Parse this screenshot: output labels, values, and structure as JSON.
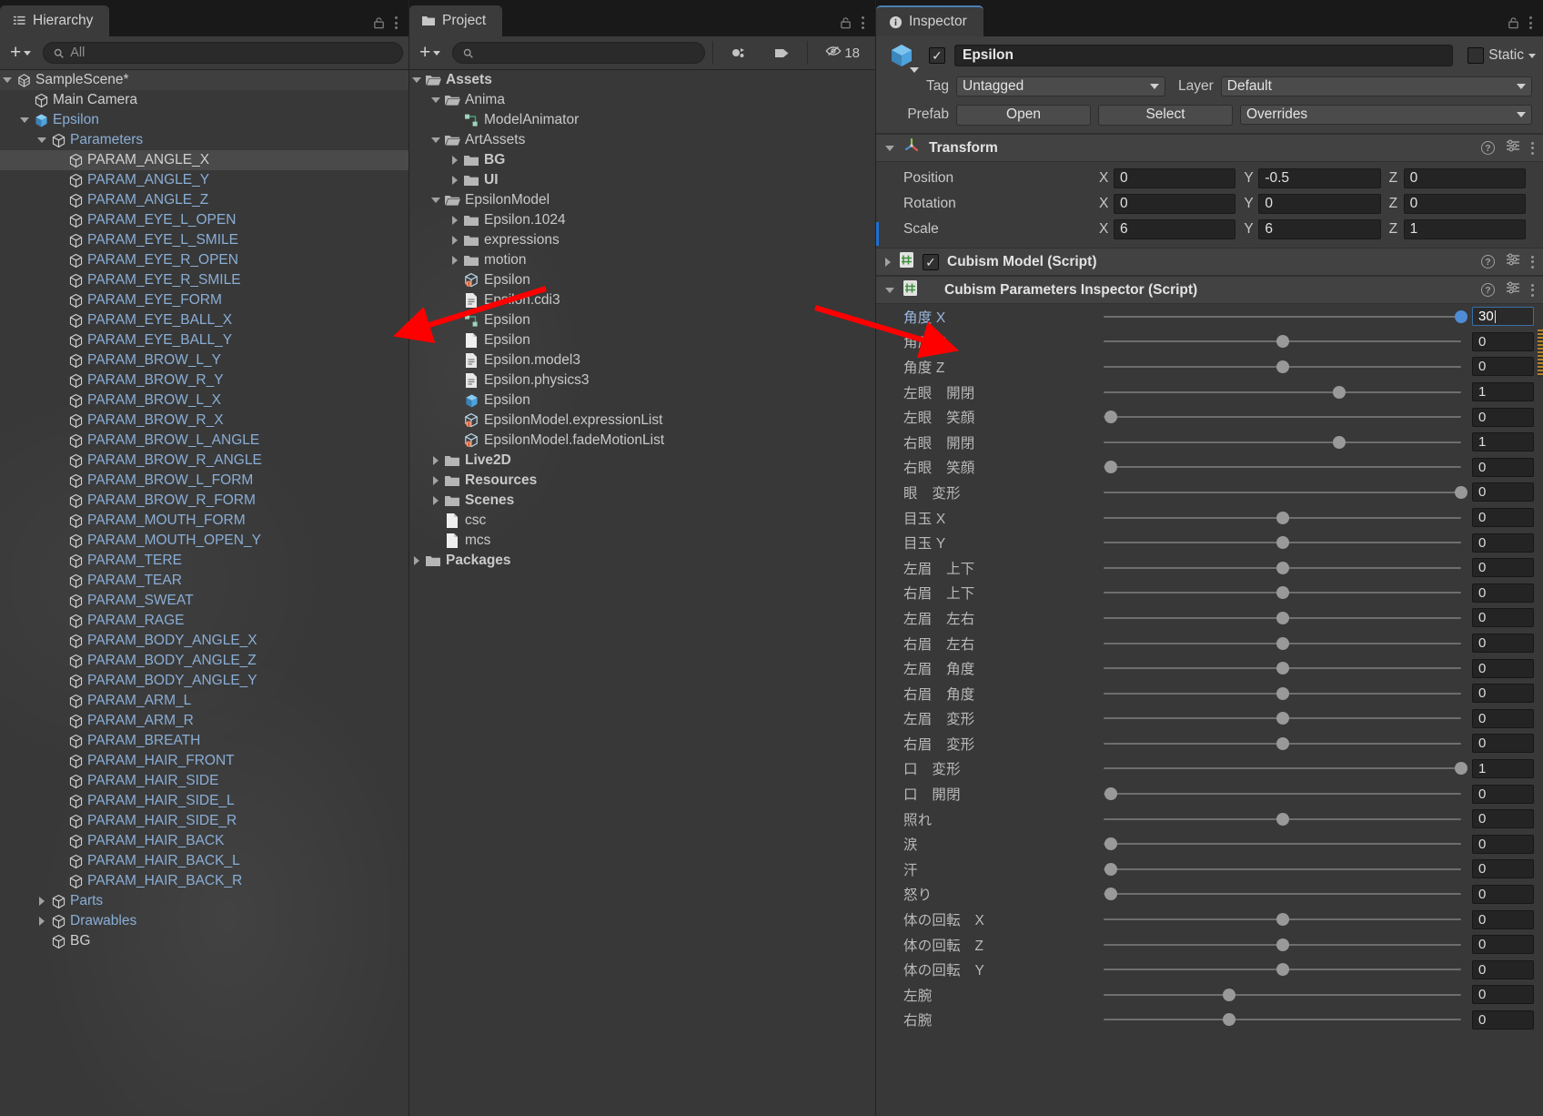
{
  "hierarchy": {
    "tab_label": "Hierarchy",
    "tab_icon": "hierarchy-icon",
    "lock_icon": "lock-icon",
    "menu_icon": "kebab-menu-icon",
    "create_label": "+",
    "search_placeholder": "All",
    "items": [
      {
        "label": "SampleScene*",
        "depth": 1,
        "twisty": "down",
        "icon": "scene-icon",
        "color": "white",
        "selected": false,
        "scene": true
      },
      {
        "label": "Main Camera",
        "depth": 2,
        "twisty": "none",
        "icon": "gameobject-icon",
        "color": "white"
      },
      {
        "label": "Epsilon",
        "depth": 2,
        "twisty": "down",
        "icon": "prefab-icon",
        "color": "blue"
      },
      {
        "label": "Parameters",
        "depth": 3,
        "twisty": "down",
        "icon": "gameobject-icon",
        "color": "blue"
      },
      {
        "label": "PARAM_ANGLE_X",
        "depth": 4,
        "twisty": "none",
        "icon": "gameobject-icon",
        "color": "white",
        "selected": true
      },
      {
        "label": "PARAM_ANGLE_Y",
        "depth": 4,
        "twisty": "none",
        "icon": "gameobject-icon",
        "color": "blue"
      },
      {
        "label": "PARAM_ANGLE_Z",
        "depth": 4,
        "twisty": "none",
        "icon": "gameobject-icon",
        "color": "blue"
      },
      {
        "label": "PARAM_EYE_L_OPEN",
        "depth": 4,
        "twisty": "none",
        "icon": "gameobject-icon",
        "color": "blue"
      },
      {
        "label": "PARAM_EYE_L_SMILE",
        "depth": 4,
        "twisty": "none",
        "icon": "gameobject-icon",
        "color": "blue"
      },
      {
        "label": "PARAM_EYE_R_OPEN",
        "depth": 4,
        "twisty": "none",
        "icon": "gameobject-icon",
        "color": "blue"
      },
      {
        "label": "PARAM_EYE_R_SMILE",
        "depth": 4,
        "twisty": "none",
        "icon": "gameobject-icon",
        "color": "blue"
      },
      {
        "label": "PARAM_EYE_FORM",
        "depth": 4,
        "twisty": "none",
        "icon": "gameobject-icon",
        "color": "blue"
      },
      {
        "label": "PARAM_EYE_BALL_X",
        "depth": 4,
        "twisty": "none",
        "icon": "gameobject-icon",
        "color": "blue"
      },
      {
        "label": "PARAM_EYE_BALL_Y",
        "depth": 4,
        "twisty": "none",
        "icon": "gameobject-icon",
        "color": "blue"
      },
      {
        "label": "PARAM_BROW_L_Y",
        "depth": 4,
        "twisty": "none",
        "icon": "gameobject-icon",
        "color": "blue"
      },
      {
        "label": "PARAM_BROW_R_Y",
        "depth": 4,
        "twisty": "none",
        "icon": "gameobject-icon",
        "color": "blue"
      },
      {
        "label": "PARAM_BROW_L_X",
        "depth": 4,
        "twisty": "none",
        "icon": "gameobject-icon",
        "color": "blue"
      },
      {
        "label": "PARAM_BROW_R_X",
        "depth": 4,
        "twisty": "none",
        "icon": "gameobject-icon",
        "color": "blue"
      },
      {
        "label": "PARAM_BROW_L_ANGLE",
        "depth": 4,
        "twisty": "none",
        "icon": "gameobject-icon",
        "color": "blue"
      },
      {
        "label": "PARAM_BROW_R_ANGLE",
        "depth": 4,
        "twisty": "none",
        "icon": "gameobject-icon",
        "color": "blue"
      },
      {
        "label": "PARAM_BROW_L_FORM",
        "depth": 4,
        "twisty": "none",
        "icon": "gameobject-icon",
        "color": "blue"
      },
      {
        "label": "PARAM_BROW_R_FORM",
        "depth": 4,
        "twisty": "none",
        "icon": "gameobject-icon",
        "color": "blue"
      },
      {
        "label": "PARAM_MOUTH_FORM",
        "depth": 4,
        "twisty": "none",
        "icon": "gameobject-icon",
        "color": "blue"
      },
      {
        "label": "PARAM_MOUTH_OPEN_Y",
        "depth": 4,
        "twisty": "none",
        "icon": "gameobject-icon",
        "color": "blue"
      },
      {
        "label": "PARAM_TERE",
        "depth": 4,
        "twisty": "none",
        "icon": "gameobject-icon",
        "color": "blue"
      },
      {
        "label": "PARAM_TEAR",
        "depth": 4,
        "twisty": "none",
        "icon": "gameobject-icon",
        "color": "blue"
      },
      {
        "label": "PARAM_SWEAT",
        "depth": 4,
        "twisty": "none",
        "icon": "gameobject-icon",
        "color": "blue"
      },
      {
        "label": "PARAM_RAGE",
        "depth": 4,
        "twisty": "none",
        "icon": "gameobject-icon",
        "color": "blue"
      },
      {
        "label": "PARAM_BODY_ANGLE_X",
        "depth": 4,
        "twisty": "none",
        "icon": "gameobject-icon",
        "color": "blue"
      },
      {
        "label": "PARAM_BODY_ANGLE_Z",
        "depth": 4,
        "twisty": "none",
        "icon": "gameobject-icon",
        "color": "blue"
      },
      {
        "label": "PARAM_BODY_ANGLE_Y",
        "depth": 4,
        "twisty": "none",
        "icon": "gameobject-icon",
        "color": "blue"
      },
      {
        "label": "PARAM_ARM_L",
        "depth": 4,
        "twisty": "none",
        "icon": "gameobject-icon",
        "color": "blue"
      },
      {
        "label": "PARAM_ARM_R",
        "depth": 4,
        "twisty": "none",
        "icon": "gameobject-icon",
        "color": "blue"
      },
      {
        "label": "PARAM_BREATH",
        "depth": 4,
        "twisty": "none",
        "icon": "gameobject-icon",
        "color": "blue"
      },
      {
        "label": "PARAM_HAIR_FRONT",
        "depth": 4,
        "twisty": "none",
        "icon": "gameobject-icon",
        "color": "blue"
      },
      {
        "label": "PARAM_HAIR_SIDE",
        "depth": 4,
        "twisty": "none",
        "icon": "gameobject-icon",
        "color": "blue"
      },
      {
        "label": "PARAM_HAIR_SIDE_L",
        "depth": 4,
        "twisty": "none",
        "icon": "gameobject-icon",
        "color": "blue"
      },
      {
        "label": "PARAM_HAIR_SIDE_R",
        "depth": 4,
        "twisty": "none",
        "icon": "gameobject-icon",
        "color": "blue"
      },
      {
        "label": "PARAM_HAIR_BACK",
        "depth": 4,
        "twisty": "none",
        "icon": "gameobject-icon",
        "color": "blue"
      },
      {
        "label": "PARAM_HAIR_BACK_L",
        "depth": 4,
        "twisty": "none",
        "icon": "gameobject-icon",
        "color": "blue"
      },
      {
        "label": "PARAM_HAIR_BACK_R",
        "depth": 4,
        "twisty": "none",
        "icon": "gameobject-icon",
        "color": "blue"
      },
      {
        "label": "Parts",
        "depth": 3,
        "twisty": "right",
        "icon": "gameobject-icon",
        "color": "blue"
      },
      {
        "label": "Drawables",
        "depth": 3,
        "twisty": "right",
        "icon": "gameobject-icon",
        "color": "blue"
      },
      {
        "label": "BG",
        "depth": 3,
        "twisty": "none",
        "icon": "gameobject-icon",
        "color": "white"
      }
    ]
  },
  "project": {
    "tab_label": "Project",
    "tab_icon": "folder-icon",
    "lock_icon": "lock-icon",
    "menu_icon": "kebab-menu-icon",
    "create_label": "+",
    "search_placeholder": "",
    "filter_type_icon": "type-filter-icon",
    "filter_label_icon": "label-filter-icon",
    "hidden_count": "18",
    "hidden_icon": "eye-off-icon",
    "items": [
      {
        "label": "Assets",
        "depth": 1,
        "twisty": "down",
        "icon": "folder-open-icon",
        "bold": true
      },
      {
        "label": "Anima",
        "depth": 2,
        "twisty": "down",
        "icon": "folder-open-icon"
      },
      {
        "label": "ModelAnimator",
        "depth": 3,
        "twisty": "none",
        "icon": "animator-controller-icon"
      },
      {
        "label": "ArtAssets",
        "depth": 2,
        "twisty": "down",
        "icon": "folder-open-icon"
      },
      {
        "label": "BG",
        "depth": 3,
        "twisty": "right",
        "icon": "folder-icon",
        "bold": true
      },
      {
        "label": "UI",
        "depth": 3,
        "twisty": "right",
        "icon": "folder-icon",
        "bold": true
      },
      {
        "label": "EpsilonModel",
        "depth": 2,
        "twisty": "down",
        "icon": "folder-open-icon"
      },
      {
        "label": "Epsilon.1024",
        "depth": 3,
        "twisty": "right",
        "icon": "folder-icon"
      },
      {
        "label": "expressions",
        "depth": 3,
        "twisty": "right",
        "icon": "folder-icon"
      },
      {
        "label": "motion",
        "depth": 3,
        "twisty": "right",
        "icon": "folder-icon"
      },
      {
        "label": "Epsilon",
        "depth": 3,
        "twisty": "none",
        "icon": "scriptable-object-icon"
      },
      {
        "label": "Epsilon.cdi3",
        "depth": 3,
        "twisty": "none",
        "icon": "text-asset-icon"
      },
      {
        "label": "Epsilon",
        "depth": 3,
        "twisty": "none",
        "icon": "animator-controller-icon"
      },
      {
        "label": "Epsilon",
        "depth": 3,
        "twisty": "none",
        "icon": "default-asset-icon"
      },
      {
        "label": "Epsilon.model3",
        "depth": 3,
        "twisty": "none",
        "icon": "text-asset-icon"
      },
      {
        "label": "Epsilon.physics3",
        "depth": 3,
        "twisty": "none",
        "icon": "text-asset-icon"
      },
      {
        "label": "Epsilon",
        "depth": 3,
        "twisty": "none",
        "icon": "prefab-icon"
      },
      {
        "label": "EpsilonModel.expressionList",
        "depth": 3,
        "twisty": "none",
        "icon": "scriptable-object-icon"
      },
      {
        "label": "EpsilonModel.fadeMotionList",
        "depth": 3,
        "twisty": "none",
        "icon": "scriptable-object-icon"
      },
      {
        "label": "Live2D",
        "depth": 2,
        "twisty": "right",
        "icon": "folder-icon",
        "bold": true
      },
      {
        "label": "Resources",
        "depth": 2,
        "twisty": "right",
        "icon": "folder-icon",
        "bold": true
      },
      {
        "label": "Scenes",
        "depth": 2,
        "twisty": "right",
        "icon": "folder-icon",
        "bold": true
      },
      {
        "label": "csc",
        "depth": 2,
        "twisty": "none",
        "icon": "default-asset-icon"
      },
      {
        "label": "mcs",
        "depth": 2,
        "twisty": "none",
        "icon": "default-asset-icon"
      },
      {
        "label": "Packages",
        "depth": 1,
        "twisty": "right",
        "icon": "folder-icon",
        "bold": true
      }
    ]
  },
  "inspector": {
    "tab_label": "Inspector",
    "tab_icon": "info-icon",
    "lock_icon": "lock-icon",
    "menu_icon": "kebab-menu-icon",
    "object_icon": "prefab-icon",
    "enabled_checkbox": true,
    "object_name": "Epsilon",
    "static_label": "Static",
    "tag_label": "Tag",
    "tag_value": "Untagged",
    "layer_label": "Layer",
    "layer_value": "Default",
    "prefab_label": "Prefab",
    "prefab_open": "Open",
    "prefab_select": "Select",
    "prefab_overrides": "Overrides",
    "transform": {
      "title": "Transform",
      "icon": "transform-icon",
      "help_icon": "help-icon",
      "preset_icon": "preset-icon",
      "menu_icon": "kebab-menu-icon",
      "rows": [
        {
          "name": "Position",
          "x": "0",
          "y": "-0.5",
          "z": "0"
        },
        {
          "name": "Rotation",
          "x": "0",
          "y": "0",
          "z": "0"
        },
        {
          "name": "Scale",
          "x": "6",
          "y": "6",
          "z": "1"
        }
      ],
      "axes": [
        "X",
        "Y",
        "Z"
      ]
    },
    "cubism_model": {
      "title": "Cubism Model (Script)",
      "icon": "script-icon",
      "enabled": true,
      "expanded": false
    },
    "cubism_params": {
      "title": "Cubism Parameters Inspector (Script)",
      "icon": "script-icon",
      "expanded": true,
      "editing_value": "30",
      "parameters": [
        {
          "label": "角度 X",
          "value": "30",
          "pos": 1.0,
          "highlight": true,
          "editing": true,
          "active": true
        },
        {
          "label": "角度 Y",
          "value": "0",
          "pos": 0.5
        },
        {
          "label": "角度 Z",
          "value": "0",
          "pos": 0.5
        },
        {
          "label": "左眼　開閉",
          "value": "1",
          "pos": 0.66
        },
        {
          "label": "左眼　笑顔",
          "value": "0",
          "pos": 0.02
        },
        {
          "label": "右眼　開閉",
          "value": "1",
          "pos": 0.66
        },
        {
          "label": "右眼　笑顔",
          "value": "0",
          "pos": 0.02
        },
        {
          "label": "眼　変形",
          "value": "0",
          "pos": 1.0
        },
        {
          "label": "目玉 X",
          "value": "0",
          "pos": 0.5
        },
        {
          "label": "目玉 Y",
          "value": "0",
          "pos": 0.5
        },
        {
          "label": "左眉　上下",
          "value": "0",
          "pos": 0.5
        },
        {
          "label": "右眉　上下",
          "value": "0",
          "pos": 0.5
        },
        {
          "label": "左眉　左右",
          "value": "0",
          "pos": 0.5
        },
        {
          "label": "右眉　左右",
          "value": "0",
          "pos": 0.5
        },
        {
          "label": "左眉　角度",
          "value": "0",
          "pos": 0.5
        },
        {
          "label": "右眉　角度",
          "value": "0",
          "pos": 0.5
        },
        {
          "label": "左眉　変形",
          "value": "0",
          "pos": 0.5
        },
        {
          "label": "右眉　変形",
          "value": "0",
          "pos": 0.5
        },
        {
          "label": "口　変形",
          "value": "1",
          "pos": 1.0
        },
        {
          "label": "口　開閉",
          "value": "0",
          "pos": 0.02
        },
        {
          "label": "照れ",
          "value": "0",
          "pos": 0.5
        },
        {
          "label": "涙",
          "value": "0",
          "pos": 0.02
        },
        {
          "label": "汗",
          "value": "0",
          "pos": 0.02
        },
        {
          "label": "怒り",
          "value": "0",
          "pos": 0.02
        },
        {
          "label": "体の回転　X",
          "value": "0",
          "pos": 0.5
        },
        {
          "label": "体の回転　Z",
          "value": "0",
          "pos": 0.5
        },
        {
          "label": "体の回転　Y",
          "value": "0",
          "pos": 0.5
        },
        {
          "label": "左腕",
          "value": "0",
          "pos": 0.35
        },
        {
          "label": "右腕",
          "value": "0",
          "pos": 0.35
        }
      ]
    }
  },
  "annotations": {
    "arrow_color": "#ff0000",
    "arrows": [
      {
        "name": "arrow-to-project-epsilon"
      },
      {
        "name": "arrow-to-angle-x-parameter"
      }
    ]
  }
}
